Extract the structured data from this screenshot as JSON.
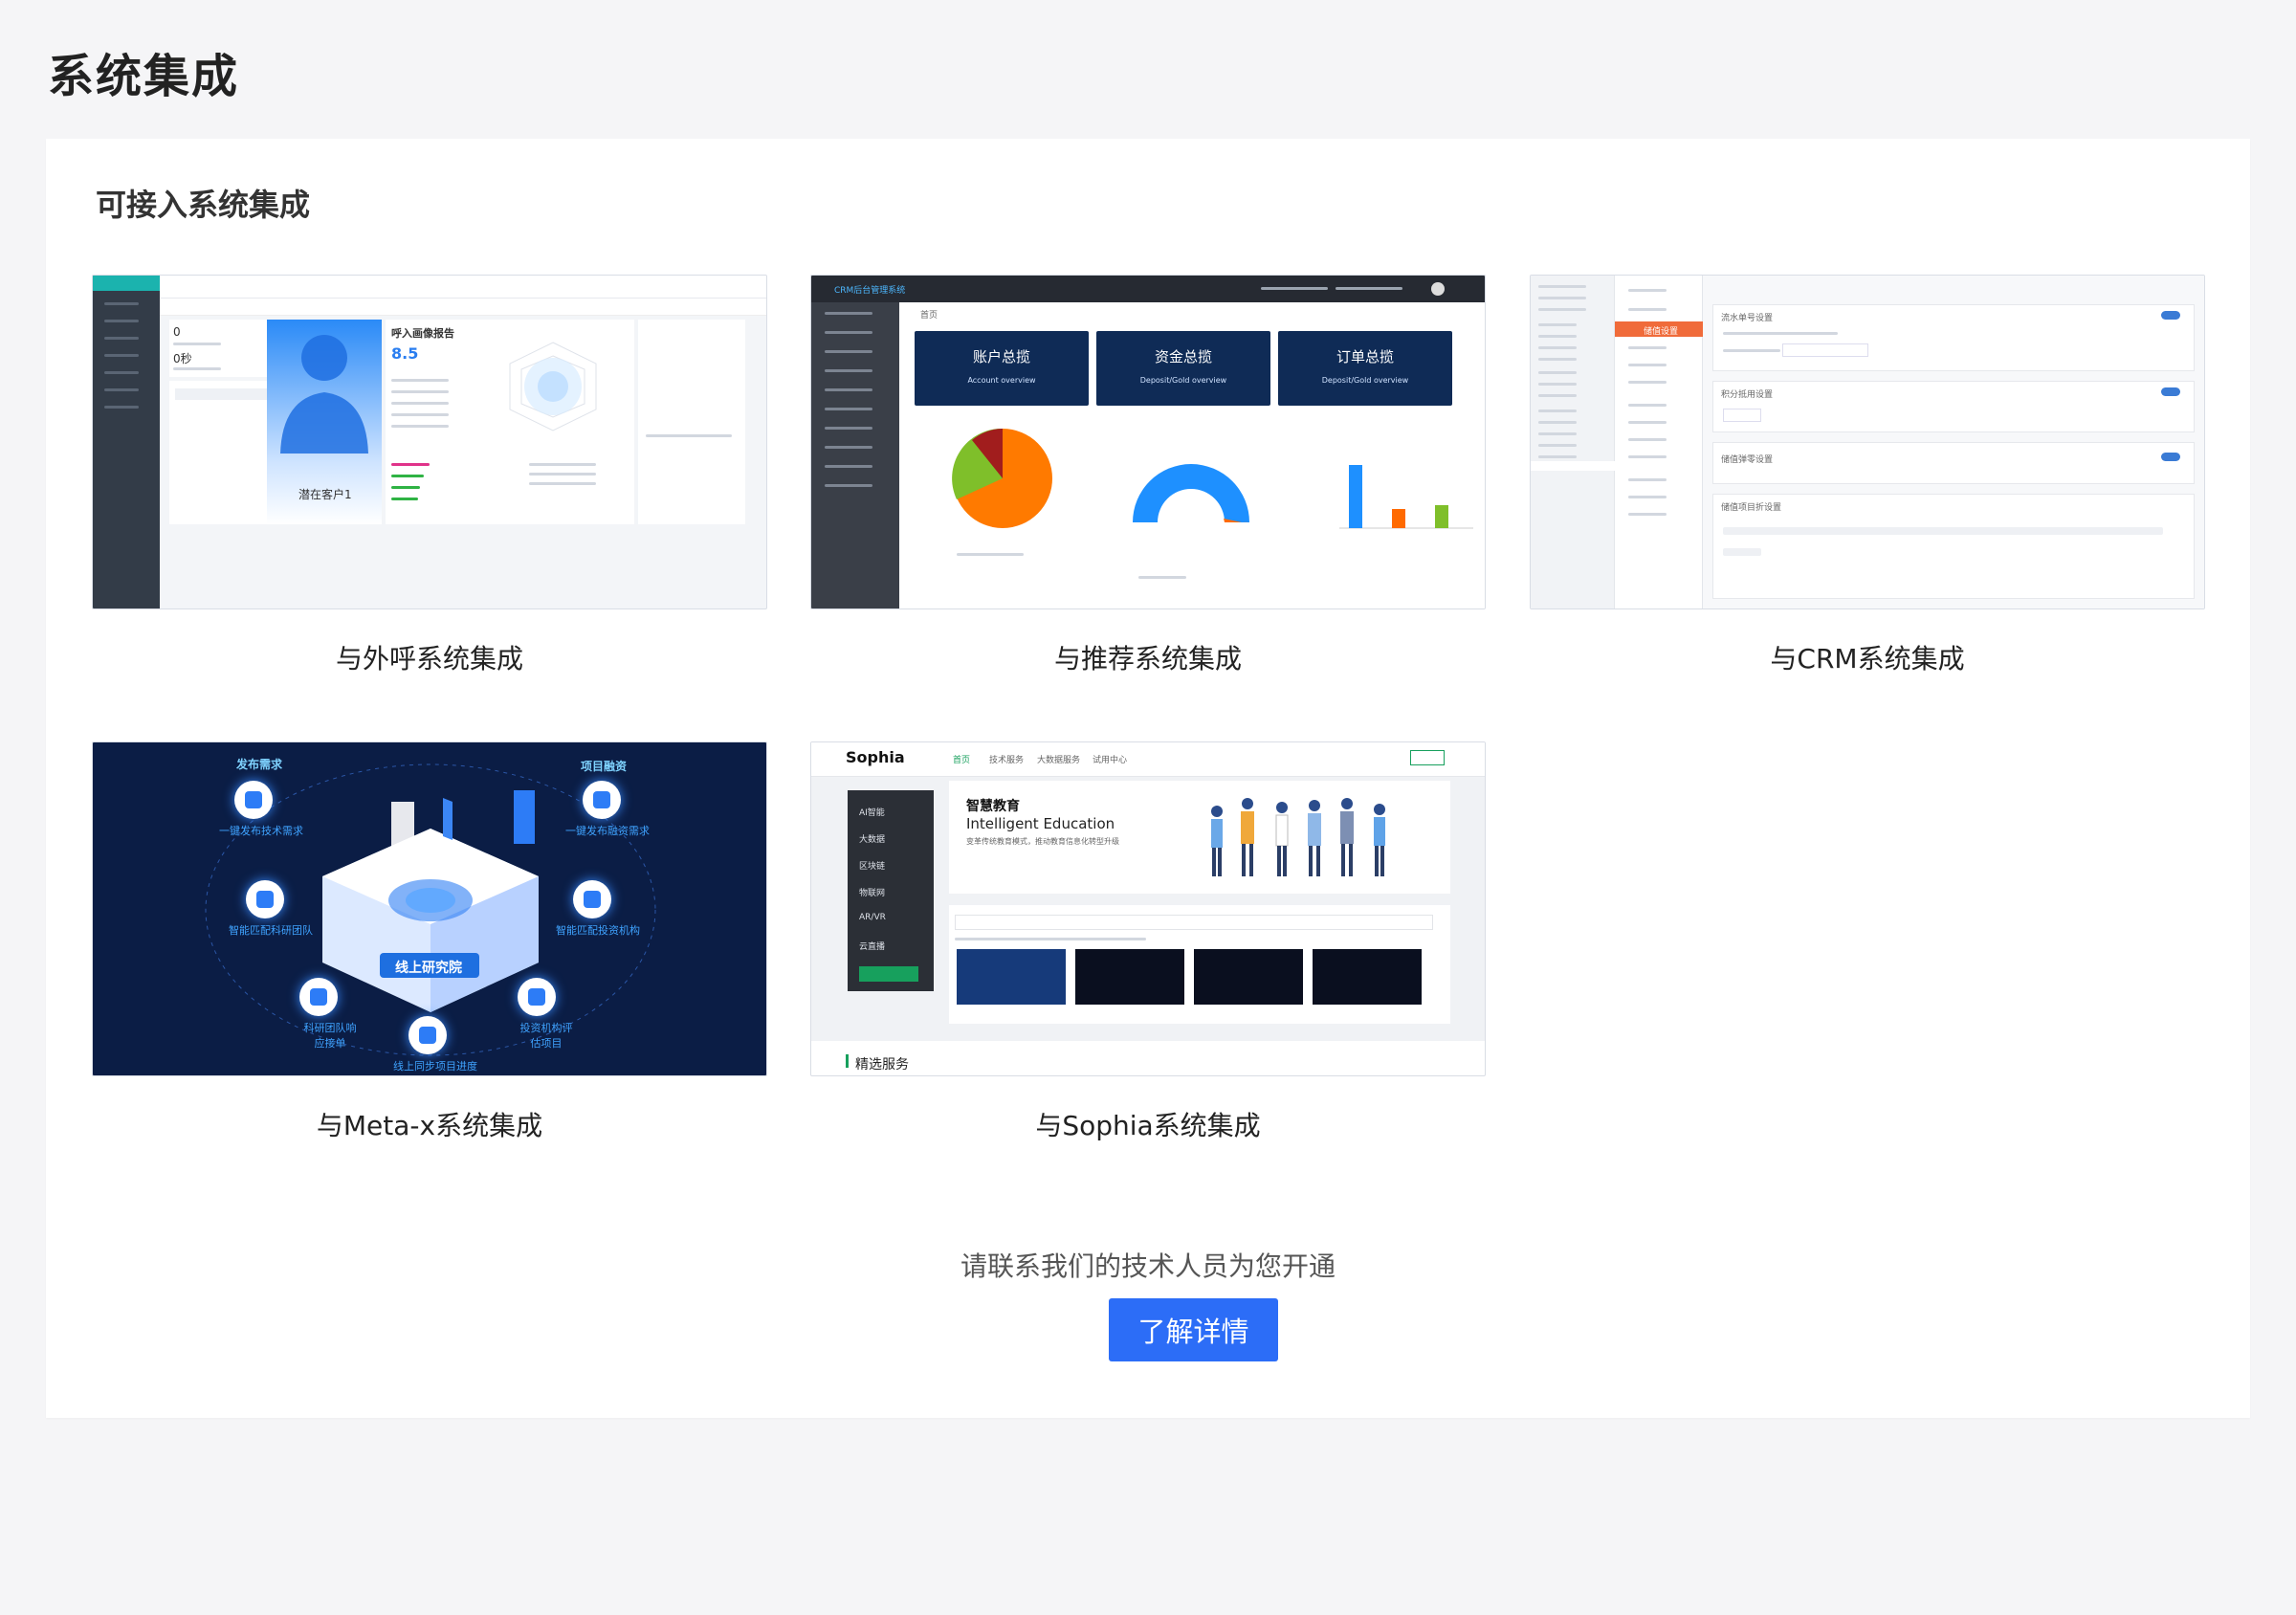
{
  "page": {
    "title": "系统集成",
    "section_title": "可接入系统集成",
    "contact_text": "请联系我们的技术人员为您开通",
    "cta_label": "了解详情"
  },
  "integrations": [
    {
      "label": "与外呼系统集成",
      "preview": {
        "report_title": "呼入画像报告",
        "score": "8.5",
        "persona_name": "潜在客户1",
        "stat_zero": "0",
        "stat_seconds": "0秒"
      }
    },
    {
      "label": "与推荐系统集成",
      "preview": {
        "app_title": "CRM后台管理系统",
        "kpi": [
          {
            "title": "账户总揽",
            "sub": "Account overview"
          },
          {
            "title": "资金总揽",
            "sub": "Deposit/Gold overview"
          },
          {
            "title": "订单总揽",
            "sub": "Deposit/Gold overview"
          }
        ],
        "tab": "首页"
      }
    },
    {
      "label": "与CRM系统集成",
      "preview": {
        "active_menu": "储值设置",
        "box_titles": [
          "流水单号设置",
          "积分抵用设置",
          "储值弹零设置",
          "储值项目折设置"
        ]
      }
    },
    {
      "label": "与Meta-x系统集成",
      "preview": {
        "center": "线上研究院",
        "top_left": "发布需求",
        "top_right": "项目融资",
        "left_mid": "一键发布技术需求",
        "right_mid": "一键发布融资需求",
        "left_low": "智能匹配科研团队",
        "right_low": "智能匹配投资机构",
        "bottom_left": "科研团队响应接单",
        "bottom_right": "投资机构评估项目",
        "bottom": "线上同步项目进度"
      }
    },
    {
      "label": "与Sophia系统集成",
      "preview": {
        "brand": "Sophia",
        "nav": [
          "首页",
          "技术服务",
          "大数据服务",
          "试用中心"
        ],
        "side": [
          "AI智能",
          "大数据",
          "区块链",
          "物联网",
          "AR/VR",
          "云直播"
        ],
        "banner_cn": "智慧教育",
        "banner_en": "Intelligent Education",
        "banner_sub": "变革传统教育模式，推动教育信息化转型升级",
        "footer_title": "精选服务"
      }
    }
  ],
  "colors": {
    "accent": "#2c6df7",
    "page_bg": "#f5f5f7",
    "card_bg": "#ffffff"
  }
}
